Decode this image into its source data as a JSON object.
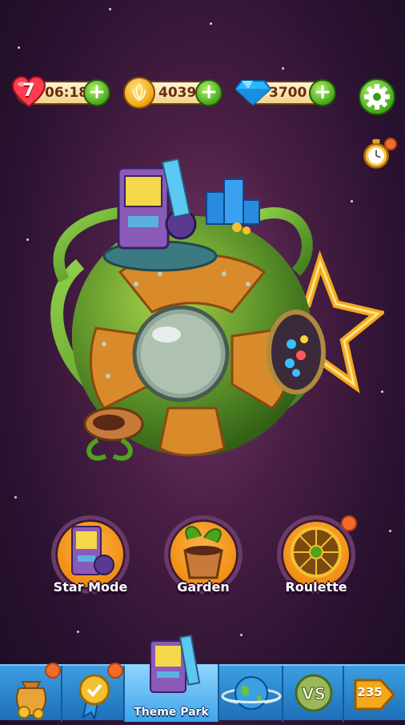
{
  "top_bar": {
    "lives": {
      "count": "7",
      "timer": "06:18"
    },
    "coins": {
      "value": "4039"
    },
    "gems": {
      "value": "3700"
    }
  },
  "modes": [
    {
      "label": "Star Mode",
      "icon": "arcade-machine-icon",
      "notification": false
    },
    {
      "label": "Garden",
      "icon": "plant-pot-icon",
      "notification": false
    },
    {
      "label": "Roulette",
      "icon": "roulette-wheel-icon",
      "notification": true
    }
  ],
  "bottom_nav": {
    "items": [
      {
        "label": "",
        "icon": "treasure-bag-icon",
        "notification": true
      },
      {
        "label": "",
        "icon": "medal-icon",
        "notification": true
      },
      {
        "label": "Theme Park",
        "icon": "arcade-machine-icon",
        "active": true
      },
      {
        "label": "",
        "icon": "planet-icon"
      },
      {
        "label": "",
        "icon": "versus-icon"
      }
    ],
    "level": "235"
  },
  "colors": {
    "accent_green": "#46a81a",
    "notification": "#f26b2a",
    "nav_blue": "#2a86d0",
    "orange": "#f08c10"
  }
}
